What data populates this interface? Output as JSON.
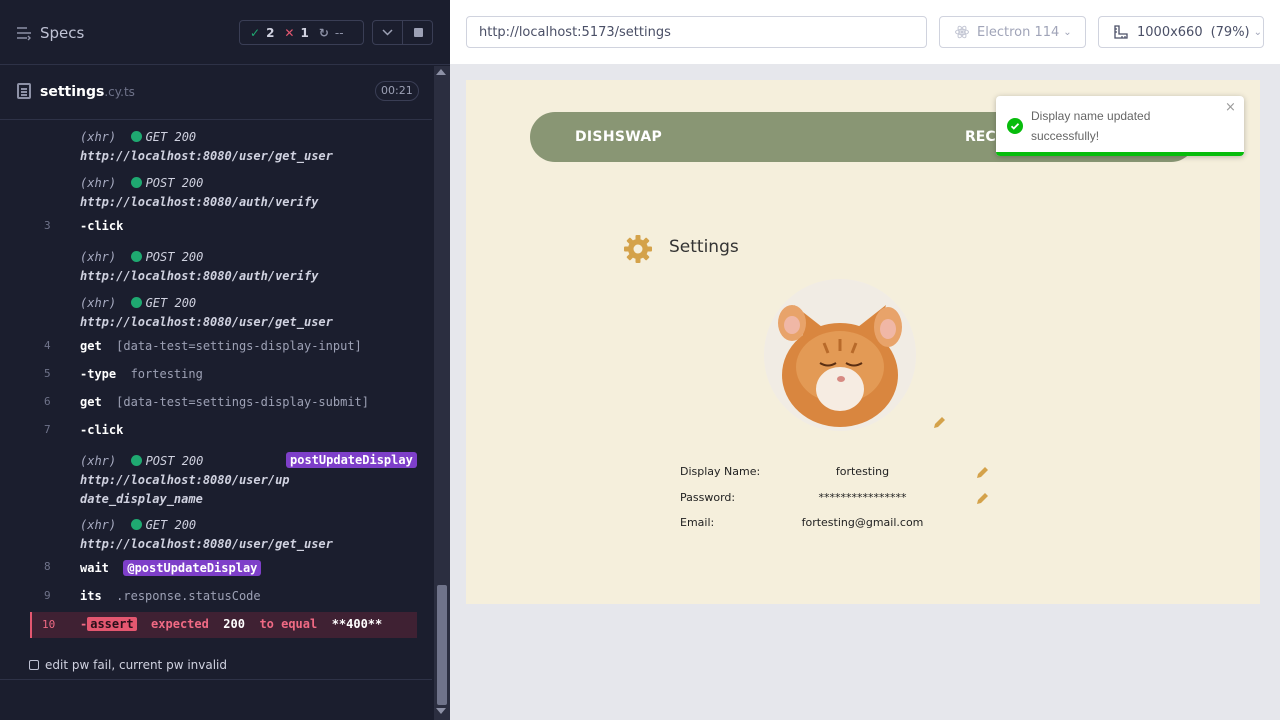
{
  "runner": {
    "specs_label": "Specs",
    "stats": {
      "passed": "2",
      "failed": "1",
      "pending": "--"
    },
    "file": {
      "name": "settings",
      "ext": ".cy.ts",
      "duration": "00:21"
    },
    "test_title": "edit pw fail, current pw invalid"
  },
  "commands": {
    "c1": {
      "xhr": "(xhr)",
      "method": "GET 200",
      "url": "http://localhost:8080/user/get_user"
    },
    "c2": {
      "xhr": "(xhr)",
      "method": "POST 200",
      "url": "http://localhost:8080/auth/verify"
    },
    "c3": {
      "num": "3",
      "name": "-click"
    },
    "c4": {
      "xhr": "(xhr)",
      "method": "POST 200",
      "url": "http://localhost:8080/auth/verify"
    },
    "c5": {
      "xhr": "(xhr)",
      "method": "GET 200",
      "url": "http://localhost:8080/user/get_user"
    },
    "c6": {
      "num": "4",
      "name": "get",
      "arg": "[data-test=settings-display-input]"
    },
    "c7": {
      "num": "5",
      "name": "-type",
      "arg": "fortesting"
    },
    "c8": {
      "num": "6",
      "name": "get",
      "arg": "[data-test=settings-display-submit]"
    },
    "c9": {
      "num": "7",
      "name": "-click"
    },
    "c10": {
      "xhr": "(xhr)",
      "method": "POST 200",
      "url1": "http://localhost:8080/user/up",
      "url2": "date_display_name",
      "alias": "postUpdateDisplay"
    },
    "c11": {
      "xhr": "(xhr)",
      "method": "GET 200",
      "url": "http://localhost:8080/user/get_user"
    },
    "c12": {
      "num": "8",
      "name": "wait",
      "alias": "@postUpdateDisplay"
    },
    "c13": {
      "num": "9",
      "name": "its",
      "arg": ".response.statusCode"
    },
    "c14": {
      "num": "10",
      "dash": "-",
      "name": "assert",
      "w1": "expected",
      "w2": "200",
      "w3": "to equal",
      "w4": "**400**"
    }
  },
  "browser": {
    "url": "http://localhost:5173/settings",
    "browser": "Electron 114",
    "viewport": "1000x660",
    "zoom": "(79%)"
  },
  "app": {
    "brand": "DISHSWAP",
    "nav_item": "RECI",
    "settings_title": "Settings",
    "fields": {
      "display_label": "Display Name:",
      "display_value": "fortesting",
      "password_label": "Password:",
      "password_value": "****************",
      "email_label": "Email:",
      "email_value": "fortesting@gmail.com"
    },
    "accent_color": "#d4a24a",
    "nav_color": "#899674"
  },
  "toast": {
    "message": "Display name updated successfully!",
    "close": "×",
    "color": "#07bc0c"
  }
}
